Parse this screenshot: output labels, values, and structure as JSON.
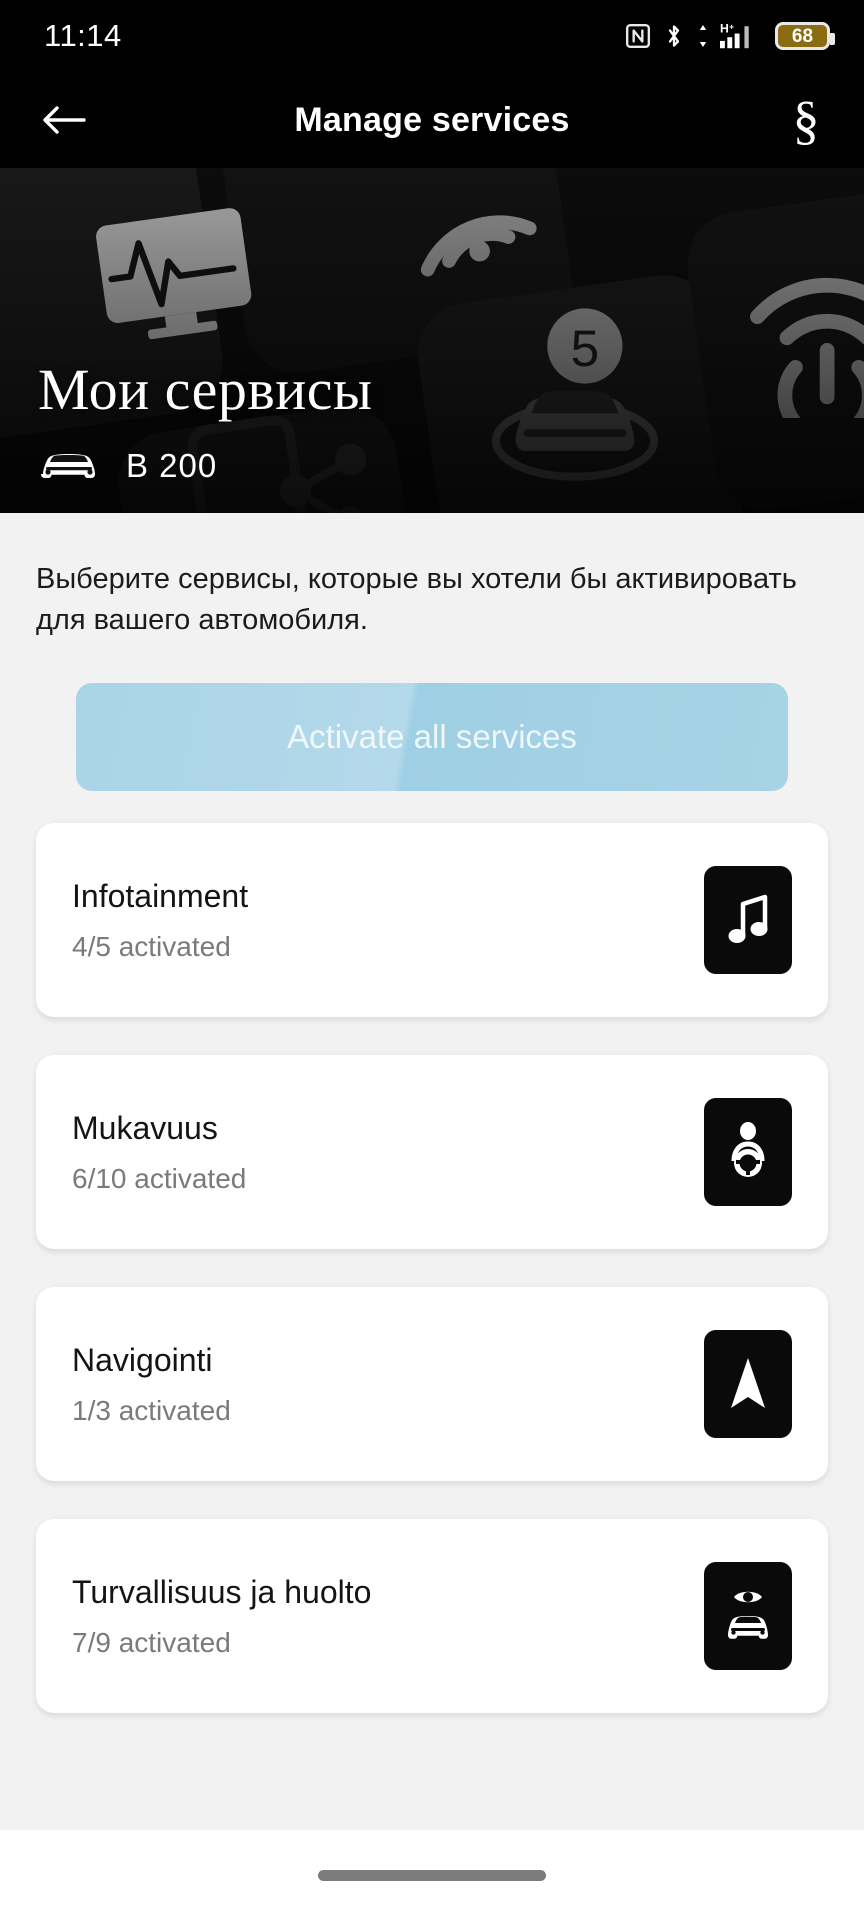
{
  "status_bar": {
    "time": "11:14",
    "battery_level": "68",
    "battery_color": "#8a6d12",
    "icons": [
      "nfc-icon",
      "bluetooth-icon",
      "mobile-data-hplus-icon",
      "signal-bars-icon",
      "battery-icon"
    ]
  },
  "app_bar": {
    "back_label": "←",
    "title": "Manage services",
    "legal_label": "§"
  },
  "hero": {
    "title": "Мои сервисы",
    "vehicle_name": "B 200",
    "vehicle_icon": "car-front-icon",
    "badge_number": "5"
  },
  "main": {
    "description": "Выберите сервисы, которые вы хотели бы активировать для вашего автомобиля.",
    "activate_all_label": "Activate all services",
    "activate_all_color": "#a9d4e7",
    "cards": [
      {
        "title": "Infotainment",
        "status": "4/5 activated",
        "icon": "music-note-icon"
      },
      {
        "title": "Mukavuus",
        "status": "6/10 activated",
        "icon": "driver-steering-wheel-icon"
      },
      {
        "title": "Navigointi",
        "status": "1/3 activated",
        "icon": "navigation-arrow-icon"
      },
      {
        "title": "Turvallisuus ja huolto",
        "status": "7/9 activated",
        "icon": "eye-over-car-icon"
      }
    ]
  },
  "nav_bar": {
    "home_indicator": "home-indicator-pill"
  }
}
